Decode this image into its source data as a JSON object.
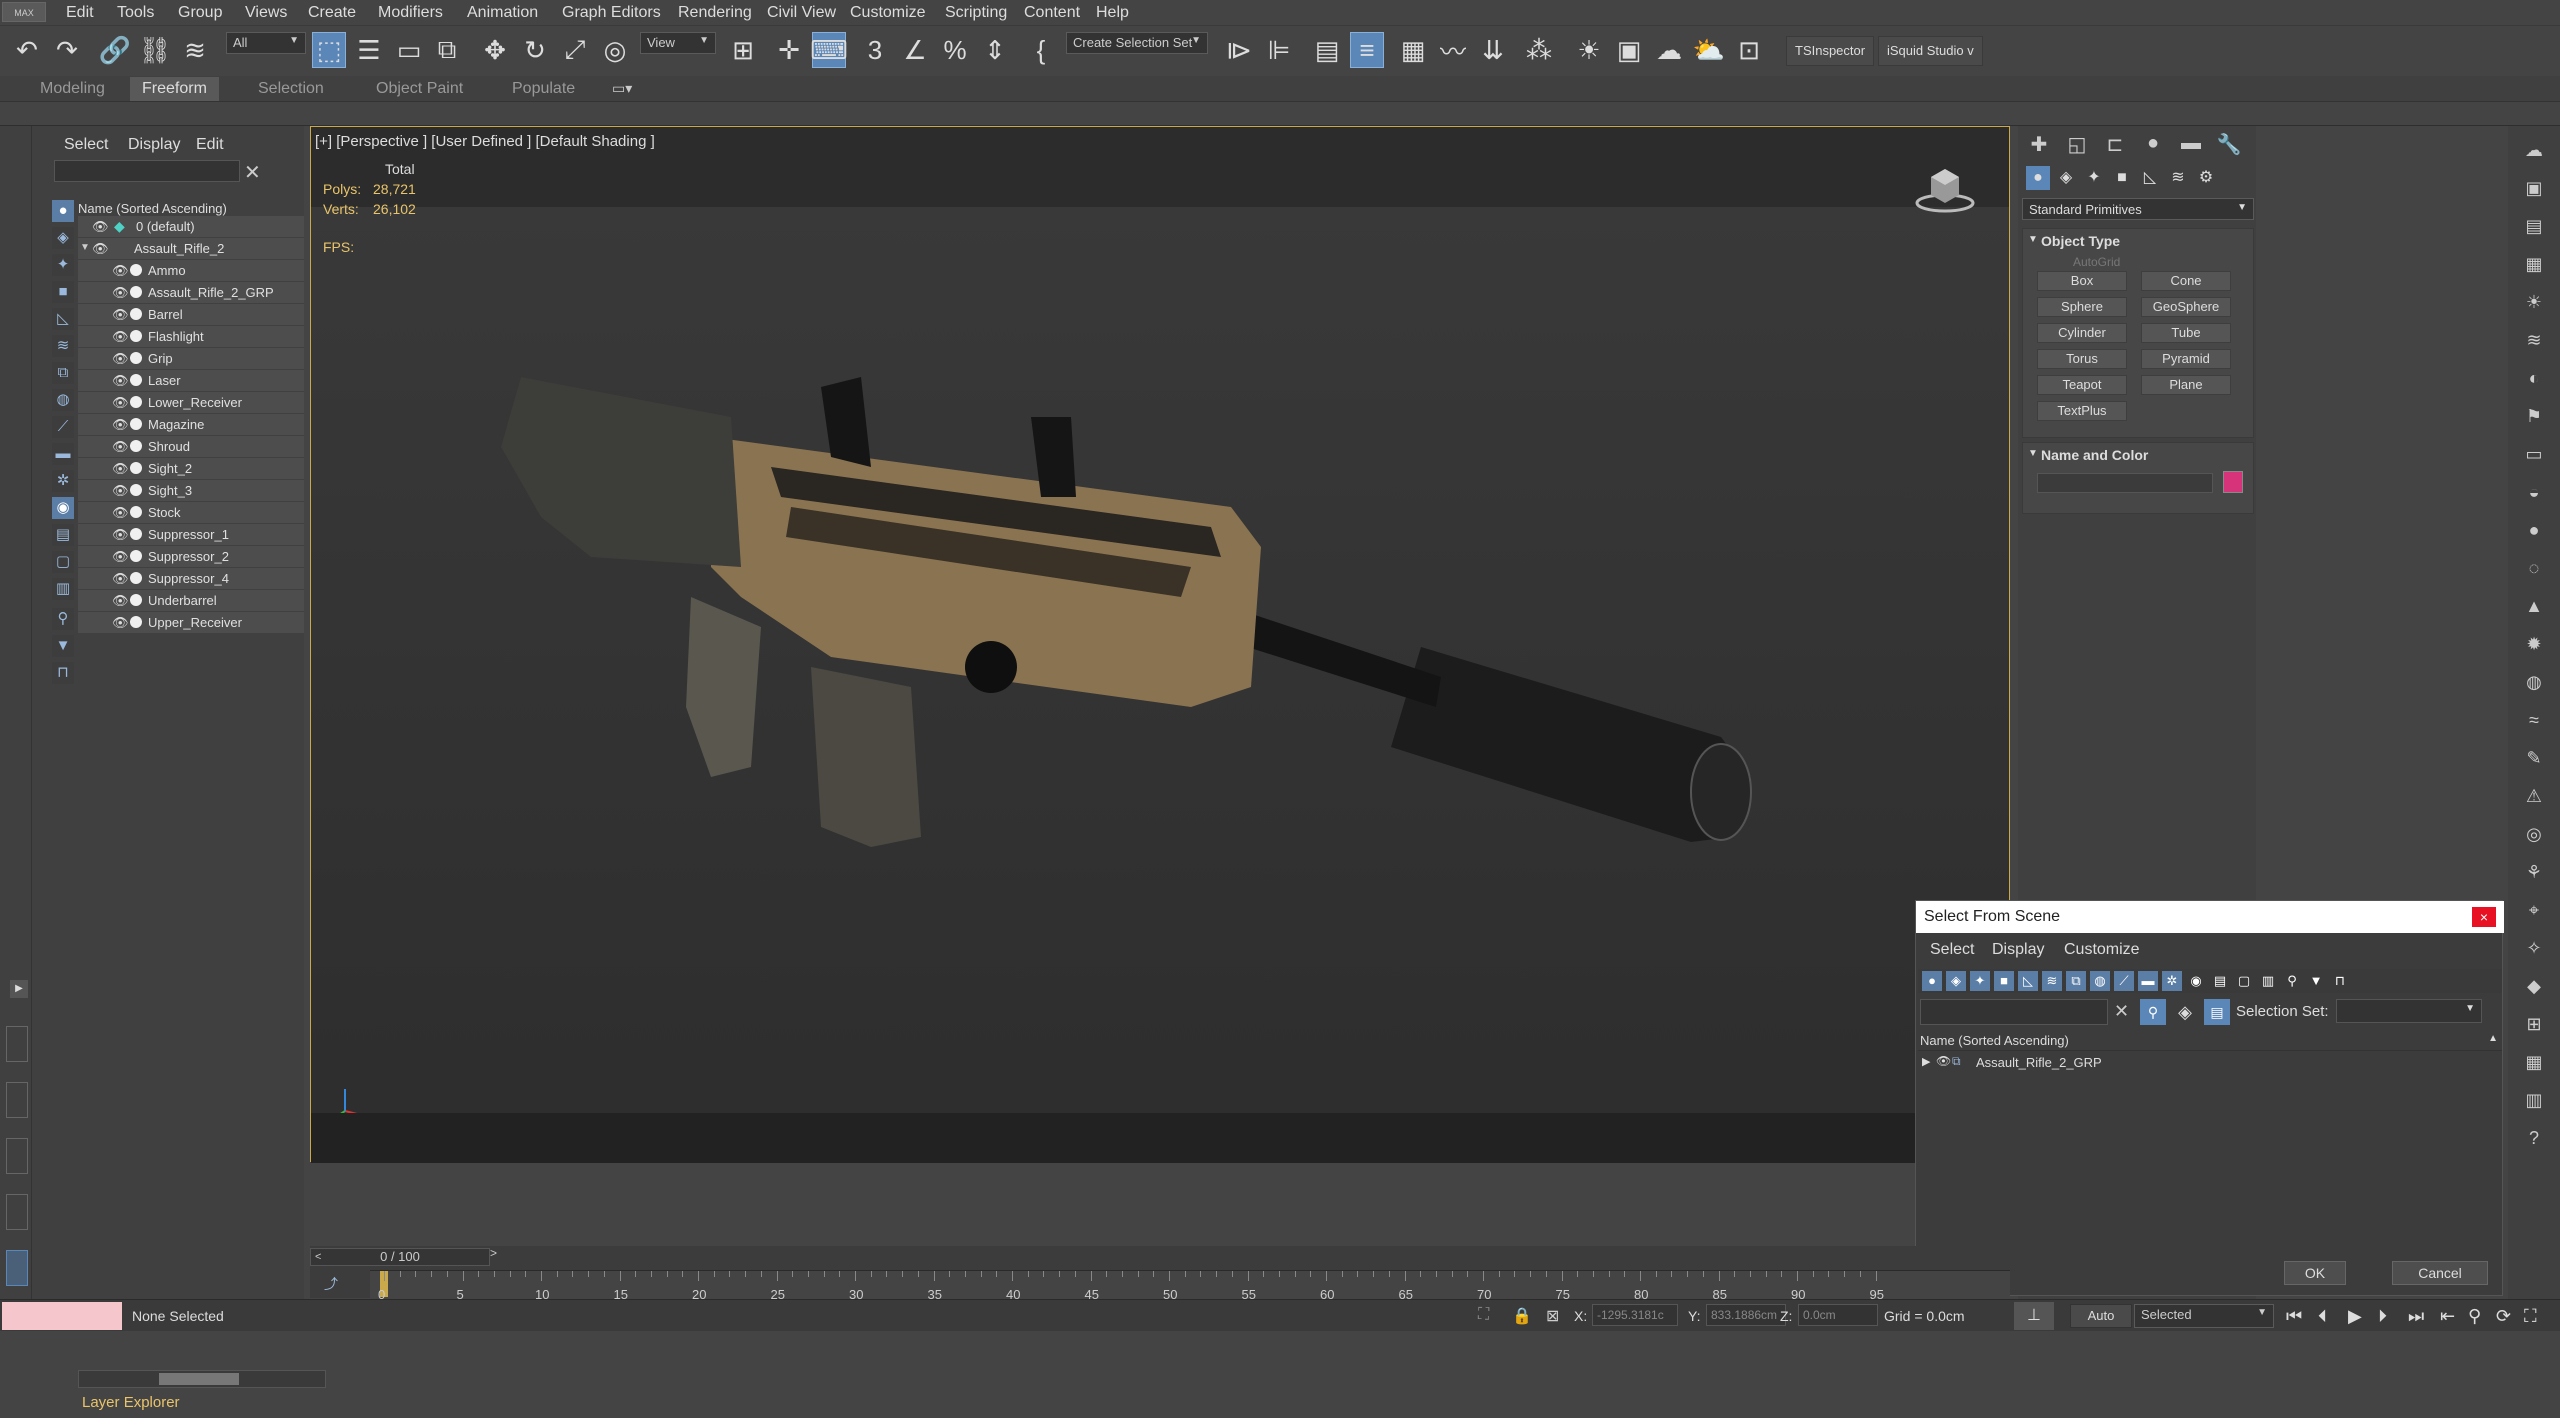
{
  "app": {
    "logo": "MAX"
  },
  "menus": [
    "Edit",
    "Tools",
    "Group",
    "Views",
    "Create",
    "Modifiers",
    "Animation",
    "Graph Editors",
    "Rendering",
    "Civil View",
    "Customize",
    "Scripting",
    "Content",
    "Help"
  ],
  "toolbar": {
    "filter_value": "All",
    "view_value": "View",
    "selection_set_placeholder": "Create Selection Set",
    "plugin1": "TSInspector",
    "plugin2": "iSquid Studio v"
  },
  "ribbon_tabs": [
    "Modeling",
    "Freeform",
    "Selection",
    "Object Paint",
    "Populate"
  ],
  "ribbon_active": "Freeform",
  "explorer": {
    "menus": [
      "Select",
      "Display",
      "Edit"
    ],
    "header": "Name (Sorted Ascending)",
    "layer": "0 (default)",
    "group": "Assault_Rifle_2",
    "items": [
      "Ammo",
      "Assault_Rifle_2_GRP",
      "Barrel",
      "Flashlight",
      "Grip",
      "Laser",
      "Lower_Receiver",
      "Magazine",
      "Shroud",
      "Sight_2",
      "Sight_3",
      "Stock",
      "Suppressor_1",
      "Suppressor_2",
      "Suppressor_4",
      "Underbarrel",
      "Upper_Receiver"
    ],
    "footer": "Layer Explorer"
  },
  "viewport": {
    "label": "[+] [Perspective ] [User Defined ] [Default Shading ]",
    "stats_header": "Total",
    "polys_label": "Polys:",
    "polys_value": "28,721",
    "verts_label": "Verts:",
    "verts_value": "26,102",
    "fps_label": "FPS:"
  },
  "command_panel": {
    "category": "Standard Primitives",
    "object_type_title": "Object Type",
    "autogrid": "AutoGrid",
    "primitives": [
      "Box",
      "Cone",
      "Sphere",
      "GeoSphere",
      "Cylinder",
      "Tube",
      "Torus",
      "Pyramid",
      "Teapot",
      "Plane",
      "TextPlus"
    ],
    "name_color_title": "Name and Color",
    "object_color": "#d6337a"
  },
  "dialog": {
    "title": "Select From Scene",
    "close": "×",
    "menus": [
      "Select",
      "Display",
      "Customize"
    ],
    "selection_set_label": "Selection Set:",
    "header": "Name (Sorted Ascending)",
    "row": "Assault_Rifle_2_GRP",
    "ok": "OK",
    "cancel": "Cancel"
  },
  "timeline": {
    "frame": "0 / 100",
    "ticks": [
      "0",
      "5",
      "10",
      "15",
      "20",
      "25",
      "30",
      "35",
      "40",
      "45",
      "50",
      "55",
      "60",
      "65",
      "70",
      "75",
      "80",
      "85",
      "90",
      "95"
    ]
  },
  "status": {
    "selection": "None Selected",
    "x_label": "X:",
    "x_value": "-1295.3181c",
    "y_label": "Y:",
    "y_value": "833.1886cm",
    "z_label": "Z:",
    "z_value": "0.0cm",
    "grid": "Grid = 0.0cm",
    "auto": "Auto",
    "key_mode": "Selected"
  },
  "colors": {
    "accent": "#5b87b8",
    "viewport_border": "#c9a94a",
    "stats": "#e9c46a"
  }
}
